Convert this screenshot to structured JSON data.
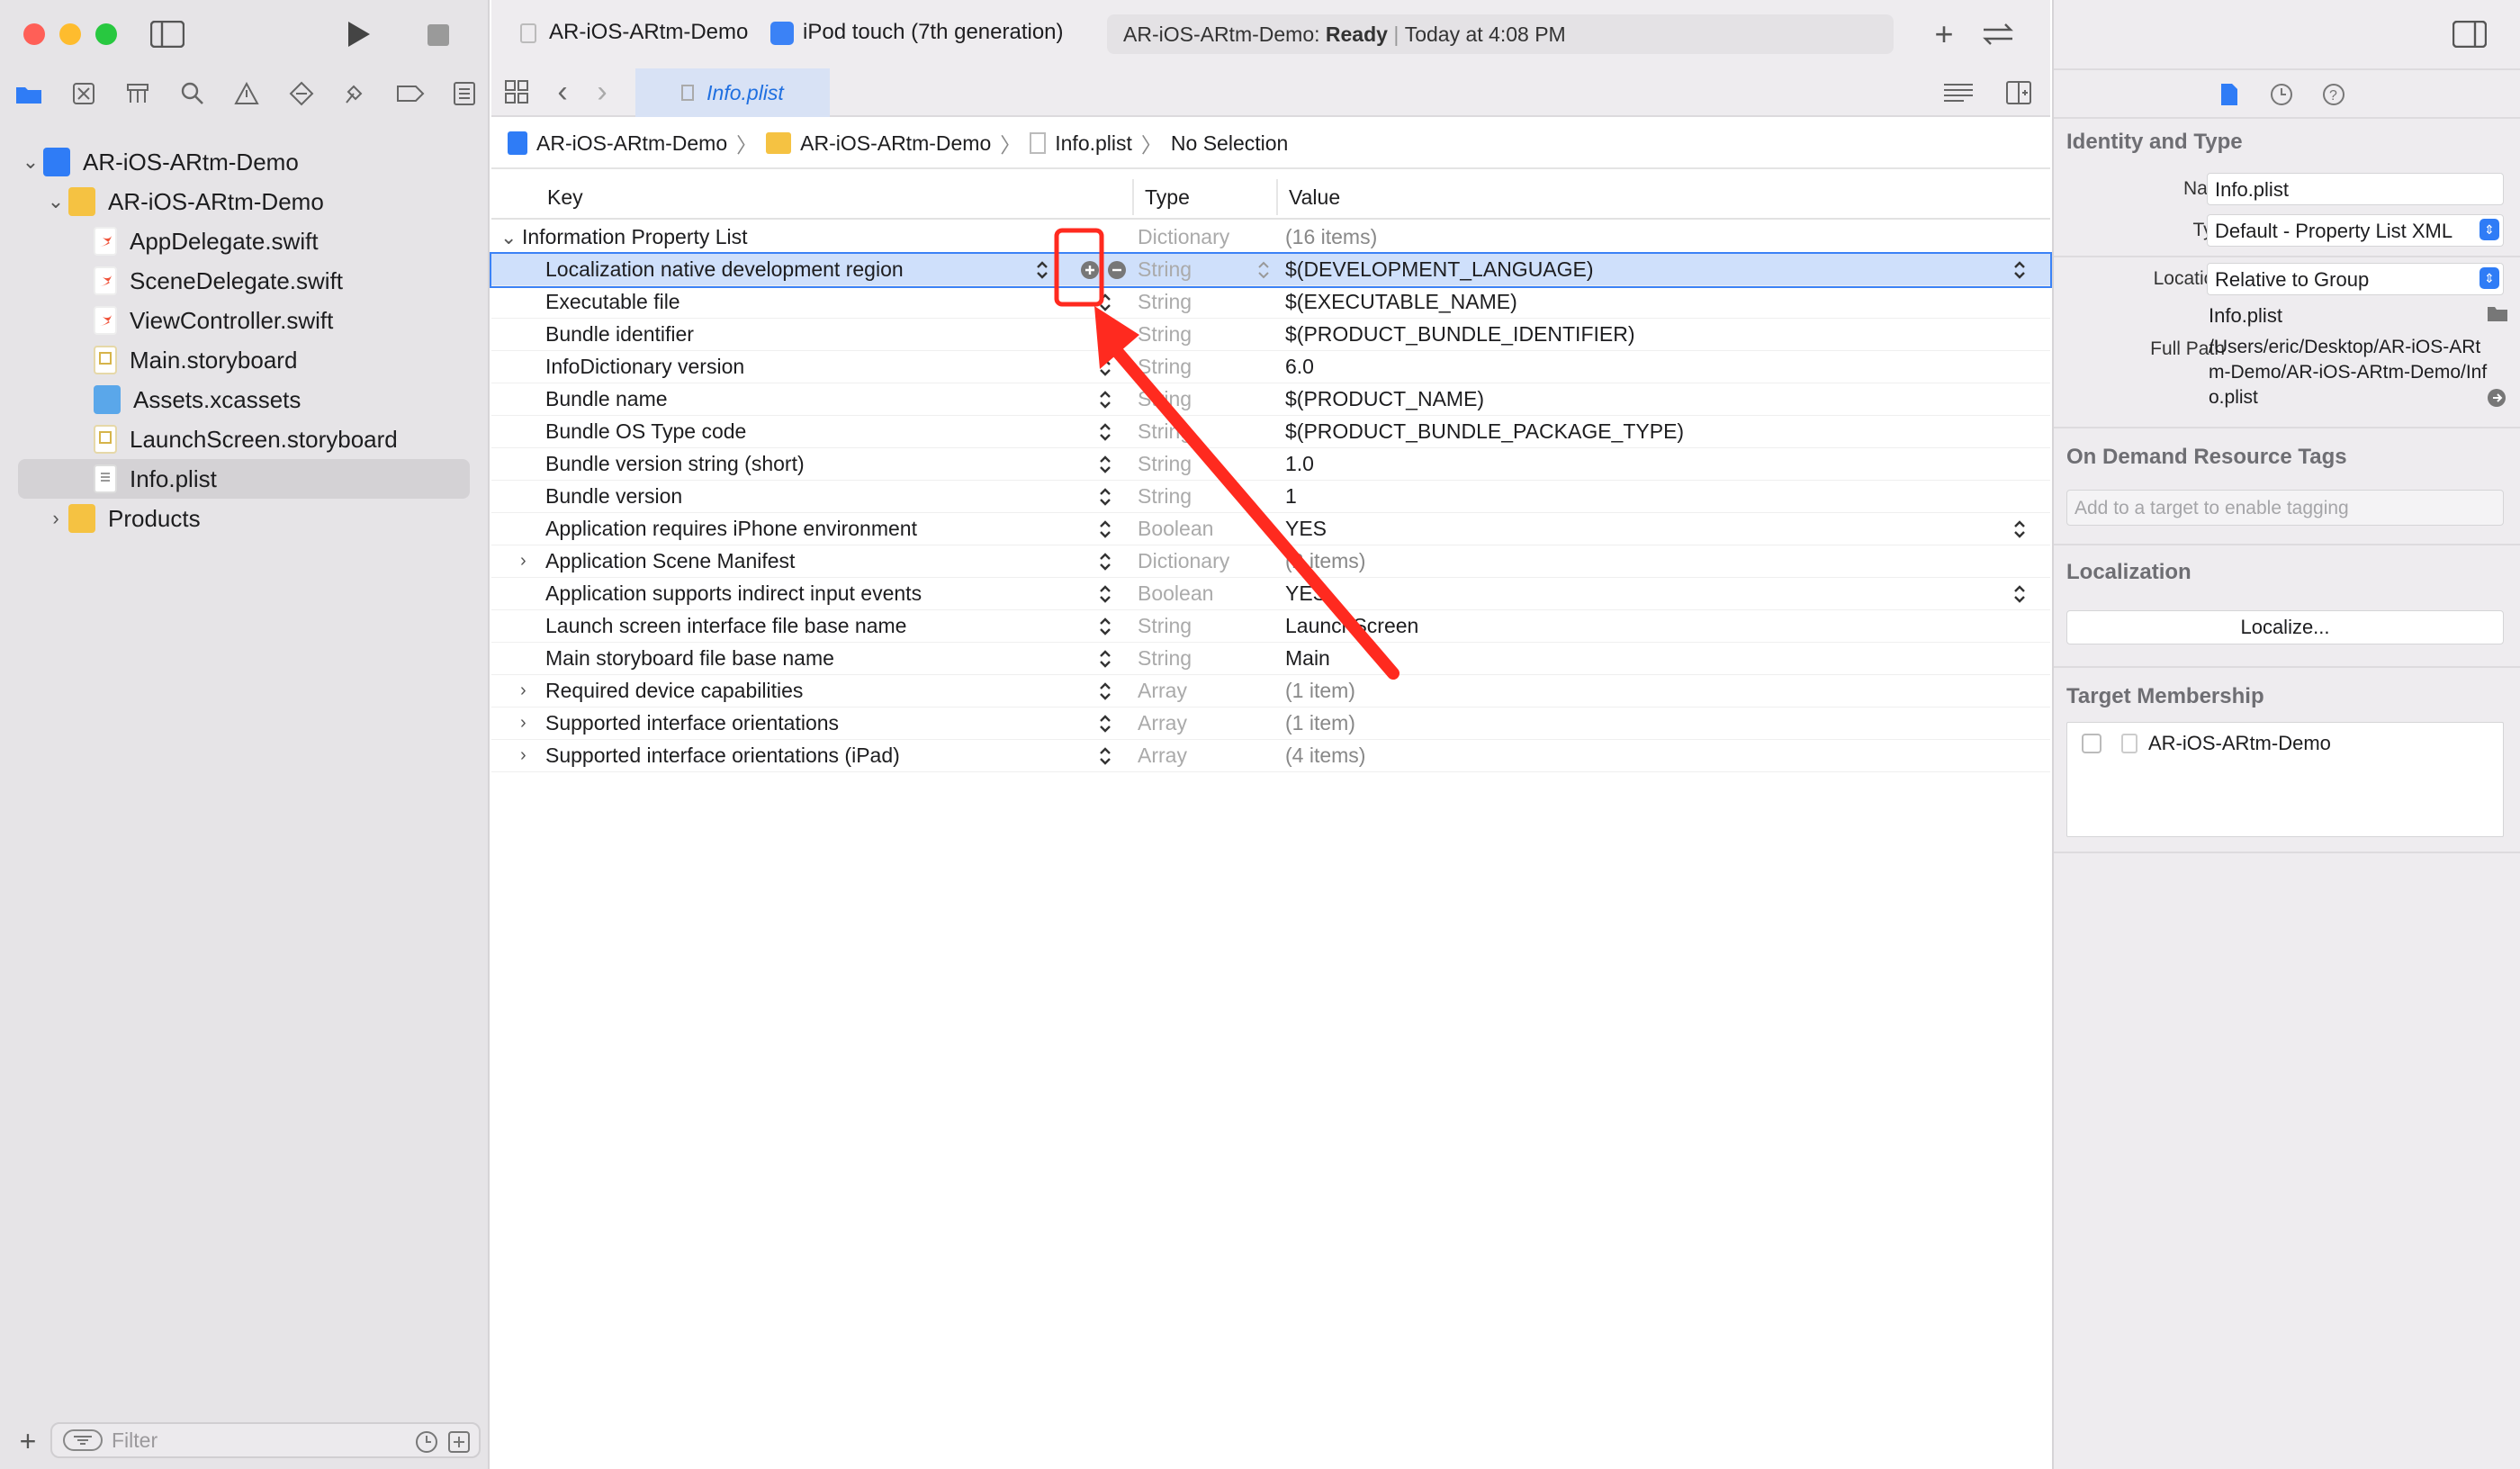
{
  "colors": {
    "accent": "#2f7cf6",
    "annotation": "#ff2a1f",
    "selection": "#cfe0fb"
  },
  "toolbar": {
    "scheme_name": "AR-iOS-ARtm-Demo",
    "device_name": "iPod touch (7th generation)",
    "status_project": "AR-iOS-ARtm-Demo:",
    "status_state": "Ready",
    "status_time": "Today at 4:08 PM"
  },
  "tab": {
    "label": "Info.plist"
  },
  "jumpbar": {
    "items": [
      "AR-iOS-ARtm-Demo",
      "AR-iOS-ARtm-Demo",
      "Info.plist",
      "No Selection"
    ]
  },
  "navigator": {
    "tree": [
      {
        "label": "AR-iOS-ARtm-Demo",
        "icon": "project-icon"
      },
      {
        "label": "AR-iOS-ARtm-Demo",
        "icon": "folder-icon"
      },
      {
        "label": "AppDelegate.swift",
        "icon": "swift-file-icon"
      },
      {
        "label": "SceneDelegate.swift",
        "icon": "swift-file-icon"
      },
      {
        "label": "ViewController.swift",
        "icon": "swift-file-icon"
      },
      {
        "label": "Main.storyboard",
        "icon": "storyboard-icon"
      },
      {
        "label": "Assets.xcassets",
        "icon": "assets-folder-icon"
      },
      {
        "label": "LaunchScreen.storyboard",
        "icon": "storyboard-icon"
      },
      {
        "label": "Info.plist",
        "icon": "plist-icon"
      },
      {
        "label": "Products",
        "icon": "folder-icon"
      }
    ],
    "filter_placeholder": "Filter"
  },
  "plist": {
    "headers": {
      "key": "Key",
      "type": "Type",
      "value": "Value"
    },
    "root": {
      "key": "Information Property List",
      "type": "Dictionary",
      "value": "(16 items)"
    },
    "rows": [
      {
        "key": "Localization native development region",
        "type": "String",
        "value": "$(DEVELOPMENT_LANGUAGE)"
      },
      {
        "key": "Executable file",
        "type": "String",
        "value": "$(EXECUTABLE_NAME)"
      },
      {
        "key": "Bundle identifier",
        "type": "String",
        "value": "$(PRODUCT_BUNDLE_IDENTIFIER)"
      },
      {
        "key": "InfoDictionary version",
        "type": "String",
        "value": "6.0"
      },
      {
        "key": "Bundle name",
        "type": "String",
        "value": "$(PRODUCT_NAME)"
      },
      {
        "key": "Bundle OS Type code",
        "type": "String",
        "value": "$(PRODUCT_BUNDLE_PACKAGE_TYPE)"
      },
      {
        "key": "Bundle version string (short)",
        "type": "String",
        "value": "1.0"
      },
      {
        "key": "Bundle version",
        "type": "String",
        "value": "1"
      },
      {
        "key": "Application requires iPhone environment",
        "type": "Boolean",
        "value": "YES"
      },
      {
        "key": "Application Scene Manifest",
        "type": "Dictionary",
        "value": "(2 items)"
      },
      {
        "key": "Application supports indirect input events",
        "type": "Boolean",
        "value": "YES"
      },
      {
        "key": "Launch screen interface file base name",
        "type": "String",
        "value": "LaunchScreen"
      },
      {
        "key": "Main storyboard file base name",
        "type": "String",
        "value": "Main"
      },
      {
        "key": "Required device capabilities",
        "type": "Array",
        "value": "(1 item)"
      },
      {
        "key": "Supported interface orientations",
        "type": "Array",
        "value": "(1 item)"
      },
      {
        "key": "Supported interface orientations (iPad)",
        "type": "Array",
        "value": "(4 items)"
      }
    ]
  },
  "inspector": {
    "identity_title": "Identity and Type",
    "name_label": "Name",
    "name_value": "Info.plist",
    "type_label": "Type",
    "type_value": "Default - Property List XML",
    "location_label": "Location",
    "location_value": "Relative to Group",
    "location_file": "Info.plist",
    "fullpath_label": "Full Path",
    "fullpath_value": "/Users/eric/Desktop/AR-iOS-ARtm-Demo/AR-iOS-ARtm-Demo/Info.plist",
    "ondemand_title": "On Demand Resource Tags",
    "tags_placeholder": "Add to a target to enable tagging",
    "localization_title": "Localization",
    "localize_button": "Localize...",
    "membership_title": "Target Membership",
    "membership_target": "AR-iOS-ARtm-Demo"
  }
}
